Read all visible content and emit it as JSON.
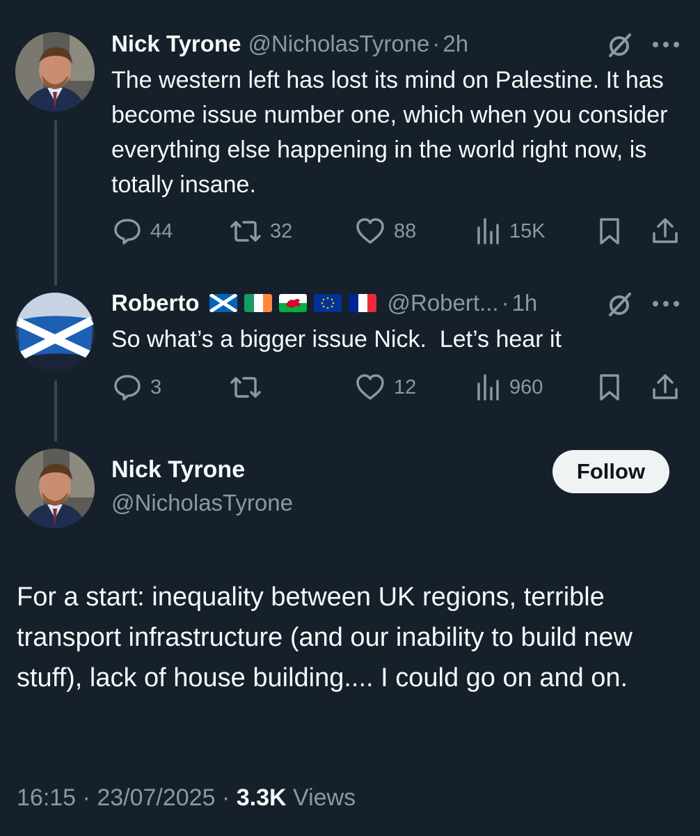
{
  "tweet1": {
    "name": "Nick Tyrone",
    "handle": "@NicholasTyrone",
    "separator": "·",
    "time": "2h",
    "text": "The western left has lost its mind on Palestine. It has become issue number one, which when you consider everything else happening in the world right now, is totally insane.",
    "replies": "44",
    "reposts": "32",
    "likes": "88",
    "views": "15K"
  },
  "tweet2": {
    "name": "Roberto",
    "flags": [
      "scotland-flag",
      "ireland-flag",
      "wales-flag",
      "eu-flag",
      "france-flag"
    ],
    "handle": "@Robert...",
    "separator": "·",
    "time": "1h",
    "text": "So what’s a bigger issue Nick.  Let’s hear it",
    "replies": "3",
    "reposts": "",
    "likes": "12",
    "views": "960"
  },
  "main": {
    "name": "Nick Tyrone",
    "handle": "@NicholasTyrone",
    "follow_label": "Follow",
    "text": "For a start: inequality between UK regions, terrible transport infrastructure (and our inability to build new stuff), lack of house building.... I could go on and on.",
    "time": "16:15",
    "date": "23/07/2025",
    "separator": "·",
    "views_count": "3.3K",
    "views_label": "Views"
  },
  "icons": {
    "reply": "reply-icon",
    "repost": "repost-icon",
    "like": "like-icon",
    "views": "views-icon",
    "bookmark": "bookmark-icon",
    "share": "share-icon",
    "grok": "grok-icon",
    "more": "more-icon"
  },
  "colors": {
    "background": "#15202b",
    "text": "#f7f9f9",
    "secondary": "#8b98a5",
    "follow_bg": "#eff3f4"
  }
}
